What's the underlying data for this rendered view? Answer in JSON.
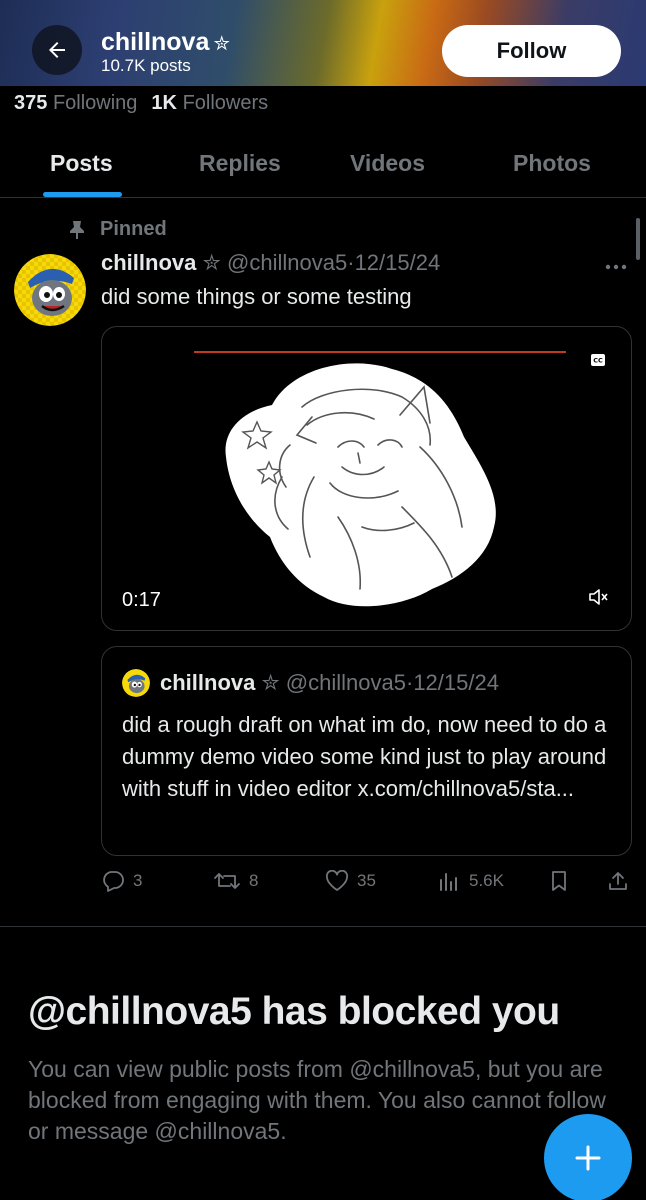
{
  "header": {
    "name": "chillnova",
    "name_badge": "✮",
    "posts_count": "10.7K posts",
    "follow_label": "Follow"
  },
  "stats": {
    "following_count": "375",
    "following_label": "Following",
    "followers_count": "1K",
    "followers_label": "Followers"
  },
  "tabs": [
    {
      "label": "Posts",
      "active": true
    },
    {
      "label": "Replies",
      "active": false
    },
    {
      "label": "Videos",
      "active": false
    },
    {
      "label": "Photos",
      "active": false
    }
  ],
  "post": {
    "pinned_label": "Pinned",
    "author_name": "chillnova",
    "author_badge": "✮",
    "handle": "@chillnova5",
    "separator": "·",
    "date": "12/15/24",
    "text": "did some things or some testing",
    "video": {
      "duration": "0:17",
      "cc_label": "CC"
    },
    "quote": {
      "author_name": "chillnova",
      "author_badge": "✮",
      "handle": "@chillnova5",
      "separator": "·",
      "date": "12/15/24",
      "text": "did a rough draft on what im do, now need to do a dummy demo video some kind just to play around with stuff in video editor x.com/chillnova5/sta..."
    },
    "actions": {
      "replies": "3",
      "reposts": "8",
      "likes": "35",
      "views": "5.6K"
    }
  },
  "blocked": {
    "title": "@chillnova5 has blocked you",
    "text": "You can view public posts from @chillnova5, but you are blocked from engaging with them. You also cannot follow or message @chillnova5."
  },
  "colors": {
    "accent": "#1d9bf0",
    "muted": "#71767b",
    "text": "#e7e9ea",
    "border": "#2f3336"
  }
}
